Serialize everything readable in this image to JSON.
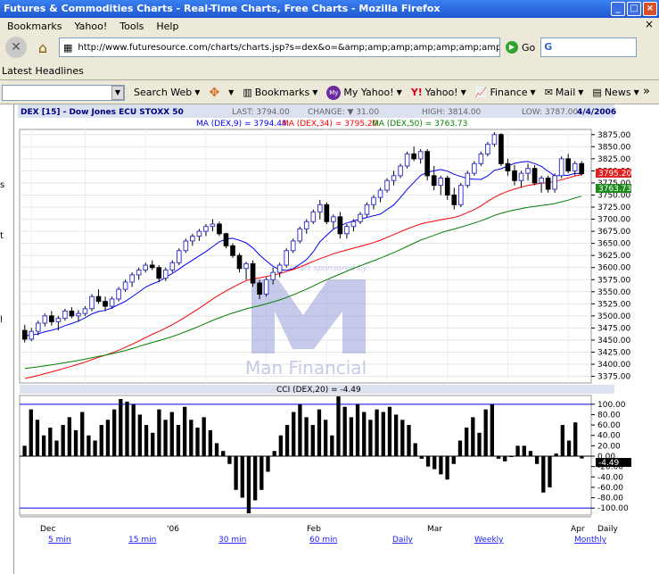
{
  "window": {
    "title": "Futures & Commodities Charts - Real-Time Charts, Free Charts - Mozilla Firefox",
    "buttons": [
      "_",
      "□",
      "×"
    ]
  },
  "menu": [
    "Bookmarks",
    "Yahoo!",
    "Tools",
    "Help"
  ],
  "url": "http://www.futuresource.com/charts/charts.jsp?s=dex&o=&amp;amp;amp;amp;amp;amp;amp;amp;amp;amp;a=D:",
  "go_label": "Go",
  "bookmarks_bar": {
    "latest": "Latest Headlines"
  },
  "yahoo_toolbar": {
    "search_web": "Search Web",
    "bookmarks": "Bookmarks",
    "my_yahoo": "My Yahoo!",
    "my_icon": "My",
    "yahoo": "Yahoo!",
    "finance": "Finance",
    "mail": "Mail",
    "news": "News",
    "more": "»"
  },
  "left_strip": {
    "letter_s": "s",
    "letter_t": "t",
    "letter_l": "l"
  },
  "chart_header": {
    "symbol": "DEX [15] - Dow Jones ECU STOXX 50",
    "last": "LAST: 3794.00",
    "change": "CHANGE: ▼ 31.00",
    "high": "HIGH: 3814.00",
    "low": "LOW: 3787.00",
    "date": "4/4/2006",
    "ma9": "MA (DEX,9) = 3794.44",
    "ma34": "MA (DEX,34) = 3795.20",
    "ma50": "MA (DEX,50) = 3763.73",
    "cci": "CCI (DEX,20) = -4.49"
  },
  "watermark": {
    "sponsored": "chart sponsored by:",
    "brand": "Man Financial"
  },
  "price_labels": {
    "ma34": "3795.20",
    "ma50": "3763.73",
    "cci": "-4.49"
  },
  "x_labels": [
    "Dec",
    "'06",
    "Feb",
    "Mar",
    "Apr"
  ],
  "periods": [
    "5 min",
    "15 min",
    "30 min",
    "60 min",
    "Daily",
    "Weekly",
    "Monthly"
  ],
  "freq": "Daily",
  "colors": {
    "ma9": "#0000ff",
    "ma34": "#ff0000",
    "ma50": "#008000",
    "header_blue": "#000080"
  },
  "chart_data": [
    {
      "type": "candlestick",
      "yticks": [
        3375,
        3400,
        3425,
        3450,
        3475,
        3500,
        3525,
        3550,
        3575,
        3600,
        3625,
        3650,
        3675,
        3700,
        3725,
        3750,
        3775,
        3800,
        3825,
        3850,
        3875
      ],
      "ylim": [
        3365,
        3882
      ],
      "ohlc": [
        [
          3470,
          3482,
          3445,
          3452
        ],
        [
          3452,
          3475,
          3448,
          3468
        ],
        [
          3468,
          3490,
          3460,
          3485
        ],
        [
          3485,
          3505,
          3478,
          3500
        ],
        [
          3500,
          3510,
          3480,
          3488
        ],
        [
          3488,
          3500,
          3470,
          3495
        ],
        [
          3495,
          3515,
          3490,
          3510
        ],
        [
          3510,
          3518,
          3495,
          3500
        ],
        [
          3500,
          3512,
          3488,
          3505
        ],
        [
          3505,
          3520,
          3500,
          3515
        ],
        [
          3515,
          3545,
          3510,
          3540
        ],
        [
          3540,
          3555,
          3525,
          3530
        ],
        [
          3530,
          3540,
          3510,
          3520
        ],
        [
          3520,
          3540,
          3515,
          3535
        ],
        [
          3535,
          3560,
          3530,
          3555
        ],
        [
          3555,
          3575,
          3550,
          3570
        ],
        [
          3570,
          3590,
          3560,
          3585
        ],
        [
          3585,
          3600,
          3575,
          3595
        ],
        [
          3595,
          3610,
          3590,
          3605
        ],
        [
          3605,
          3615,
          3595,
          3600
        ],
        [
          3600,
          3605,
          3570,
          3578
        ],
        [
          3578,
          3600,
          3572,
          3595
        ],
        [
          3595,
          3615,
          3590,
          3610
        ],
        [
          3610,
          3640,
          3605,
          3635
        ],
        [
          3635,
          3660,
          3630,
          3655
        ],
        [
          3655,
          3670,
          3645,
          3665
        ],
        [
          3665,
          3680,
          3655,
          3675
        ],
        [
          3675,
          3690,
          3665,
          3685
        ],
        [
          3685,
          3700,
          3675,
          3690
        ],
        [
          3690,
          3695,
          3665,
          3670
        ],
        [
          3670,
          3672,
          3640,
          3645
        ],
        [
          3645,
          3650,
          3620,
          3625
        ],
        [
          3625,
          3630,
          3590,
          3598
        ],
        [
          3598,
          3612,
          3575,
          3608
        ],
        [
          3608,
          3615,
          3560,
          3568
        ],
        [
          3568,
          3575,
          3535,
          3545
        ],
        [
          3545,
          3580,
          3540,
          3575
        ],
        [
          3575,
          3600,
          3565,
          3590
        ],
        [
          3590,
          3610,
          3580,
          3605
        ],
        [
          3605,
          3640,
          3600,
          3635
        ],
        [
          3635,
          3660,
          3630,
          3655
        ],
        [
          3655,
          3685,
          3650,
          3680
        ],
        [
          3680,
          3700,
          3670,
          3695
        ],
        [
          3695,
          3720,
          3690,
          3715
        ],
        [
          3715,
          3740,
          3700,
          3730
        ],
        [
          3730,
          3735,
          3690,
          3695
        ],
        [
          3695,
          3710,
          3680,
          3705
        ],
        [
          3705,
          3715,
          3660,
          3670
        ],
        [
          3670,
          3690,
          3660,
          3685
        ],
        [
          3685,
          3700,
          3675,
          3695
        ],
        [
          3695,
          3715,
          3690,
          3710
        ],
        [
          3710,
          3735,
          3705,
          3730
        ],
        [
          3730,
          3750,
          3720,
          3745
        ],
        [
          3745,
          3765,
          3735,
          3760
        ],
        [
          3760,
          3785,
          3755,
          3780
        ],
        [
          3780,
          3800,
          3770,
          3790
        ],
        [
          3790,
          3815,
          3785,
          3810
        ],
        [
          3810,
          3840,
          3805,
          3835
        ],
        [
          3835,
          3850,
          3820,
          3825
        ],
        [
          3825,
          3845,
          3815,
          3840
        ],
        [
          3840,
          3845,
          3780,
          3790
        ],
        [
          3790,
          3810,
          3760,
          3770
        ],
        [
          3770,
          3790,
          3750,
          3785
        ],
        [
          3785,
          3790,
          3740,
          3750
        ],
        [
          3750,
          3765,
          3720,
          3730
        ],
        [
          3730,
          3775,
          3725,
          3770
        ],
        [
          3770,
          3800,
          3765,
          3795
        ],
        [
          3795,
          3820,
          3790,
          3815
        ],
        [
          3815,
          3840,
          3810,
          3835
        ],
        [
          3835,
          3860,
          3830,
          3855
        ],
        [
          3855,
          3880,
          3850,
          3875
        ],
        [
          3875,
          3878,
          3810,
          3815
        ],
        [
          3815,
          3825,
          3790,
          3800
        ],
        [
          3800,
          3812,
          3770,
          3780
        ],
        [
          3780,
          3800,
          3765,
          3795
        ],
        [
          3795,
          3815,
          3780,
          3805
        ],
        [
          3805,
          3812,
          3770,
          3775
        ],
        [
          3775,
          3790,
          3755,
          3785
        ],
        [
          3785,
          3790,
          3755,
          3762
        ],
        [
          3762,
          3795,
          3755,
          3790
        ],
        [
          3790,
          3830,
          3785,
          3825
        ],
        [
          3825,
          3835,
          3795,
          3800
        ],
        [
          3800,
          3820,
          3790,
          3815
        ],
        [
          3815,
          3820,
          3790,
          3794
        ]
      ],
      "ma9_first_last": [
        3460,
        3794.44
      ],
      "ma34_first_last": [
        3368,
        3795.2
      ],
      "ma50_first_last": [
        3390,
        3763.73
      ]
    },
    {
      "type": "bar",
      "name": "CCI (DEX,20)",
      "yticks": [
        100,
        80,
        60,
        40,
        20,
        0,
        -20,
        -40,
        -60,
        -80,
        -100
      ],
      "ylim": [
        -110,
        110
      ],
      "values": [
        20,
        90,
        70,
        40,
        55,
        30,
        60,
        75,
        50,
        85,
        40,
        30,
        60,
        70,
        90,
        110,
        105,
        100,
        80,
        60,
        45,
        90,
        70,
        85,
        60,
        95,
        70,
        55,
        75,
        50,
        25,
        10,
        -15,
        -65,
        -80,
        -110,
        -85,
        -65,
        -30,
        10,
        40,
        60,
        85,
        100,
        75,
        60,
        90,
        70,
        40,
        115,
        95,
        75,
        100,
        85,
        70,
        90,
        85,
        95,
        80,
        70,
        60,
        25,
        -5,
        -20,
        -25,
        -35,
        -45,
        -15,
        30,
        55,
        75,
        45,
        90,
        100,
        -5,
        -10,
        0,
        20,
        20,
        10,
        -15,
        -70,
        -60,
        5,
        60,
        30,
        65,
        -4.49
      ]
    }
  ]
}
